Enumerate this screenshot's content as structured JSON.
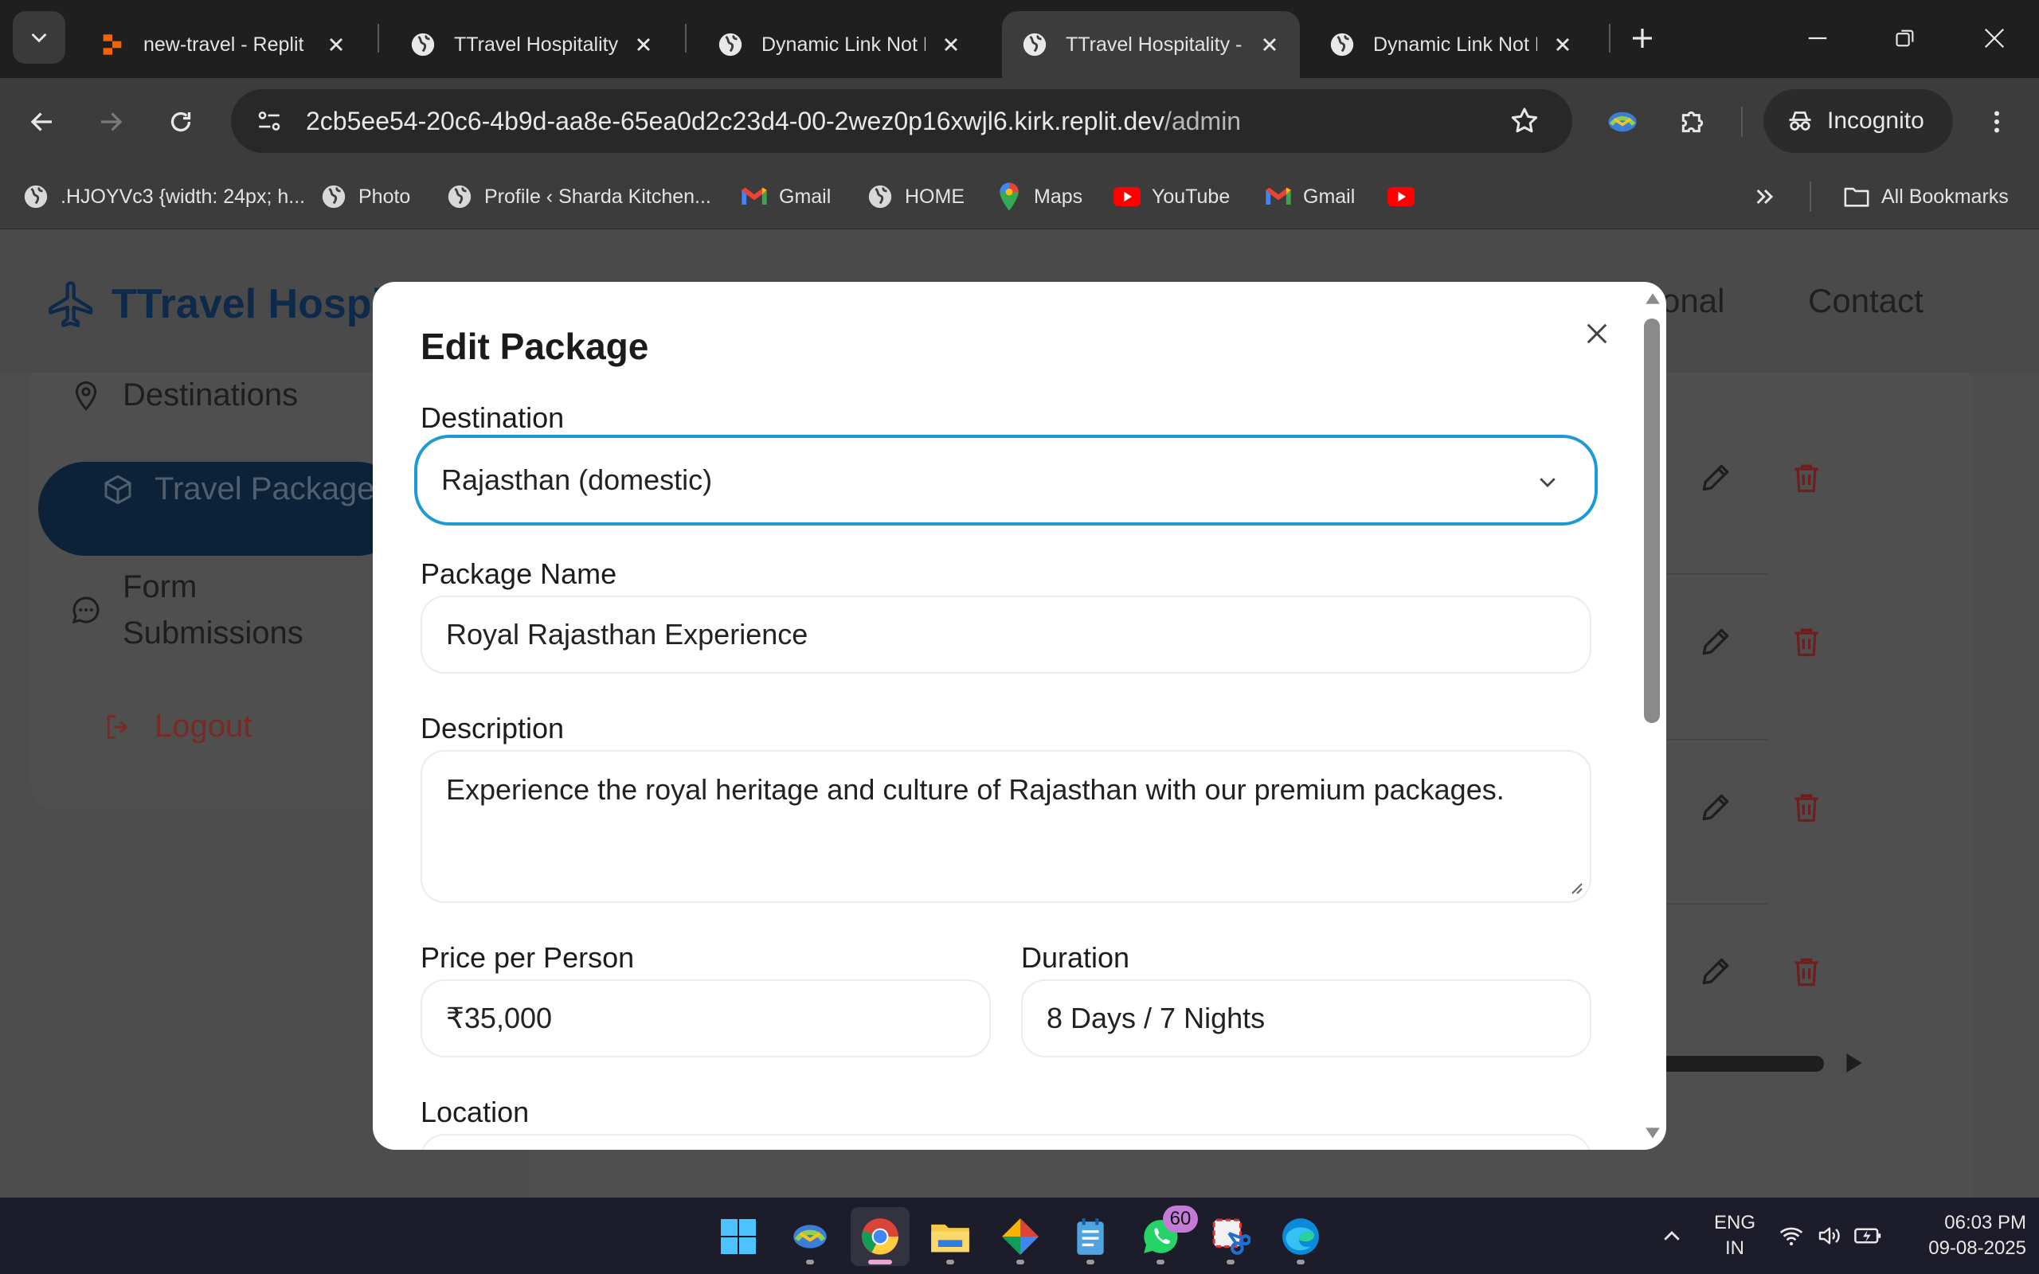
{
  "browser": {
    "tabs": [
      {
        "title": "new-travel - Replit",
        "favicon": "replit-icon",
        "active": false
      },
      {
        "title": "TTravel Hospitality -",
        "favicon": "globe-icon",
        "active": false
      },
      {
        "title": "Dynamic Link Not Fo",
        "favicon": "globe-icon",
        "active": false
      },
      {
        "title": "TTravel Hospitality -",
        "favicon": "globe-icon",
        "active": true
      },
      {
        "title": "Dynamic Link Not Fo",
        "favicon": "globe-icon",
        "active": false
      }
    ],
    "url_host": "2cb5ee54-20c6-4b9d-aa8e-65ea0d2c23d4-00-2wez0p16xwjl6.kirk.replit.dev",
    "url_path": "/admin",
    "profile_label": "Incognito",
    "bookmarks": [
      {
        "label": ".HJOYVc3 {width: 24px; h...",
        "icon": "globe-icon"
      },
      {
        "label": "Photo",
        "icon": "globe-icon"
      },
      {
        "label": "Profile ‹ Sharda Kitchen...",
        "icon": "globe-icon"
      },
      {
        "label": "Gmail",
        "icon": "gmail-icon"
      },
      {
        "label": "HOME",
        "icon": "globe-icon"
      },
      {
        "label": "Maps",
        "icon": "maps-icon"
      },
      {
        "label": "YouTube",
        "icon": "youtube-icon"
      },
      {
        "label": "Gmail",
        "icon": "gmail-icon"
      }
    ],
    "all_bookmarks_label": "All Bookmarks"
  },
  "site": {
    "brand": "TTravel Hospi",
    "nav": [
      "onal",
      "Contact"
    ],
    "sidebar": [
      {
        "label": "Destinations",
        "icon": "map-pin-icon"
      },
      {
        "label": "Travel Package",
        "icon": "box-icon",
        "active": true
      },
      {
        "label": "Form\nSubmissions",
        "icon": "chat-icon"
      },
      {
        "label": "Logout",
        "icon": "logout-icon"
      }
    ]
  },
  "modal": {
    "title": "Edit Package",
    "fields": {
      "destination": {
        "label": "Destination",
        "value": "Rajasthan (domestic)"
      },
      "package_name": {
        "label": "Package Name",
        "value": "Royal Rajasthan Experience"
      },
      "description": {
        "label": "Description",
        "value": "Experience the royal heritage and culture of Rajasthan with our premium packages."
      },
      "price": {
        "label": "Price per Person",
        "value": "₹35,000"
      },
      "duration": {
        "label": "Duration",
        "value": "8 Days / 7 Nights"
      },
      "location": {
        "label": "Location",
        "value": ""
      }
    }
  },
  "taskbar": {
    "whatsapp_badge": "60",
    "lang_line1": "ENG",
    "lang_line2": "IN",
    "time": "06:03 PM",
    "date": "09-08-2025"
  },
  "colors": {
    "focus_ring": "#1d9ad6",
    "brand_navy": "#0e2a4a",
    "delete_red": "#b02a2a",
    "logout_red": "#c0392b"
  }
}
